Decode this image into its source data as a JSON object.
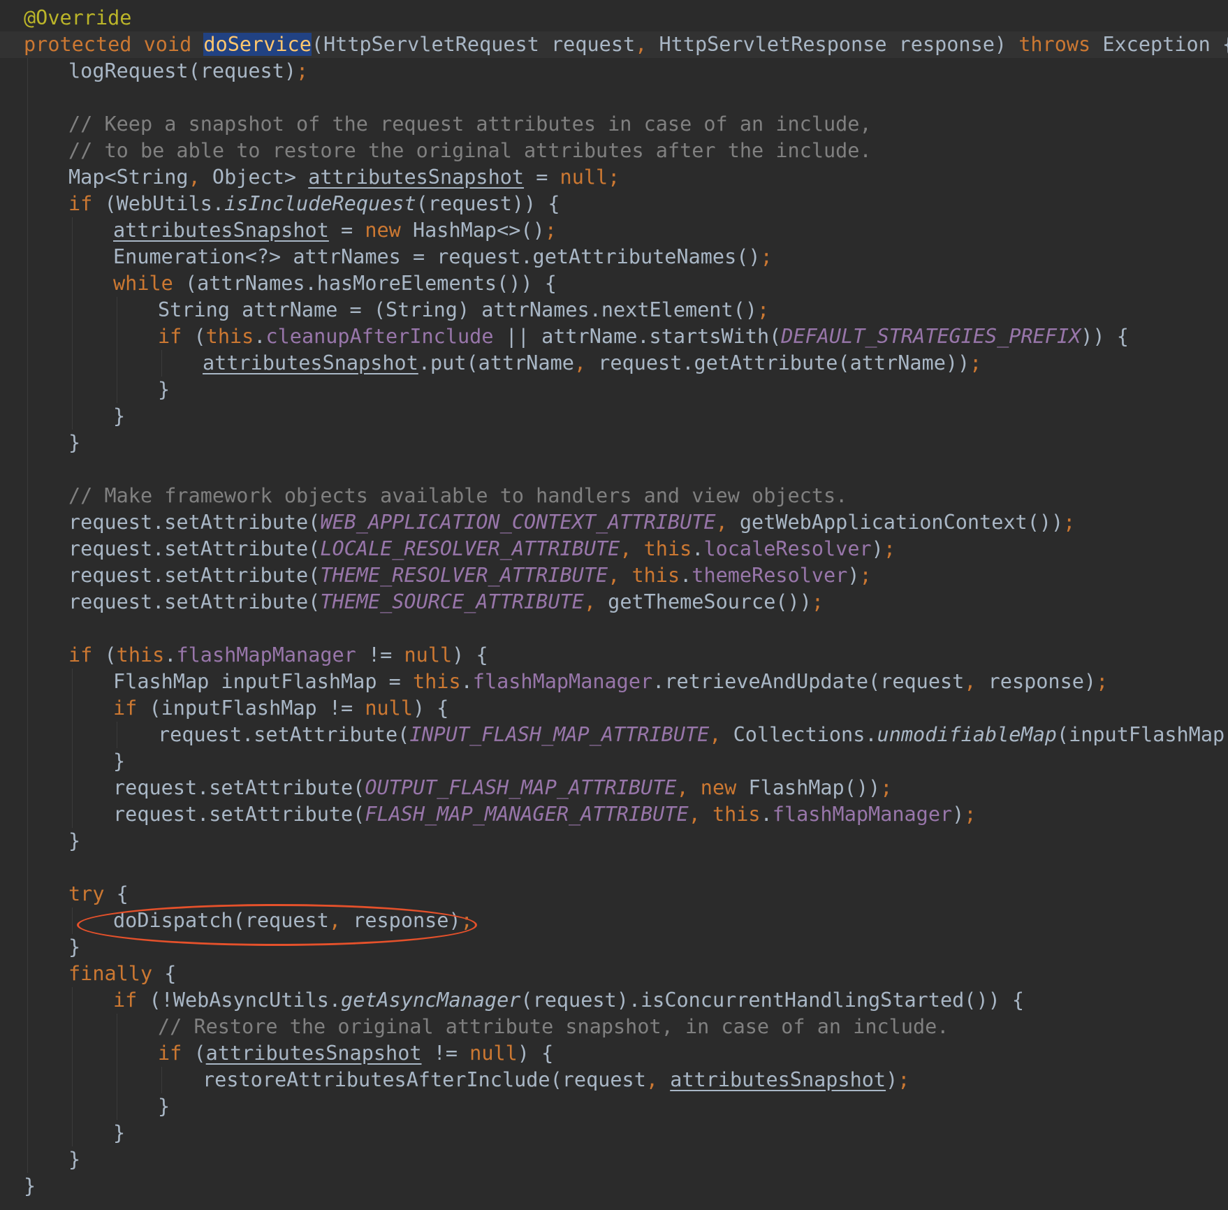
{
  "editor": {
    "language": "java",
    "colors": {
      "background": "#2b2b2b",
      "caret_row": "#323232",
      "plain": "#a9b7c6",
      "keyword": "#cc7832",
      "annotation": "#bbb529",
      "comment": "#808080",
      "field": "#9876aa",
      "method_declaration": "#ffc66d",
      "usage_highlight": "#214283",
      "annotation_ellipse": "#e5512b"
    },
    "lines": [
      {
        "indent": 0,
        "tokens": [
          {
            "t": "@Override",
            "c": "ann"
          }
        ]
      },
      {
        "indent": 0,
        "caret": true,
        "tokens": [
          {
            "t": "protected",
            "c": "kw"
          },
          {
            "t": " ",
            "c": "plain"
          },
          {
            "t": "void",
            "c": "kw"
          },
          {
            "t": " ",
            "c": "plain"
          },
          {
            "t": "doService",
            "c": "hl"
          },
          {
            "t": "(HttpServletRequest request",
            "c": "plain"
          },
          {
            "t": ",",
            "c": "punc"
          },
          {
            "t": " HttpServletResponse response) ",
            "c": "plain"
          },
          {
            "t": "throws",
            "c": "kw"
          },
          {
            "t": " Exception {",
            "c": "plain"
          }
        ]
      },
      {
        "indent": 1,
        "tokens": [
          {
            "t": "logRequest(request)",
            "c": "plain"
          },
          {
            "t": ";",
            "c": "punc"
          }
        ]
      },
      {
        "indent": 1,
        "tokens": []
      },
      {
        "indent": 1,
        "tokens": [
          {
            "t": "// Keep a snapshot of the request attributes in case of an include,",
            "c": "comment"
          }
        ]
      },
      {
        "indent": 1,
        "tokens": [
          {
            "t": "// to be able to restore the original attributes after the include.",
            "c": "comment"
          }
        ]
      },
      {
        "indent": 1,
        "tokens": [
          {
            "t": "Map<String",
            "c": "plain"
          },
          {
            "t": ",",
            "c": "punc"
          },
          {
            "t": " Object> ",
            "c": "plain"
          },
          {
            "t": "attributesSnapshot",
            "c": "local"
          },
          {
            "t": " = ",
            "c": "plain"
          },
          {
            "t": "null;",
            "c": "kw"
          }
        ]
      },
      {
        "indent": 1,
        "tokens": [
          {
            "t": "if",
            "c": "kw"
          },
          {
            "t": " (WebUtils.",
            "c": "plain"
          },
          {
            "t": "isIncludeRequest",
            "c": "static"
          },
          {
            "t": "(request)) {",
            "c": "plain"
          }
        ]
      },
      {
        "indent": 2,
        "tokens": [
          {
            "t": "attributesSnapshot",
            "c": "local"
          },
          {
            "t": " = ",
            "c": "plain"
          },
          {
            "t": "new",
            "c": "kw"
          },
          {
            "t": " HashMap<>()",
            "c": "plain"
          },
          {
            "t": ";",
            "c": "punc"
          }
        ]
      },
      {
        "indent": 2,
        "tokens": [
          {
            "t": "Enumeration<?> attrNames = request.getAttributeNames()",
            "c": "plain"
          },
          {
            "t": ";",
            "c": "punc"
          }
        ]
      },
      {
        "indent": 2,
        "tokens": [
          {
            "t": "while",
            "c": "kw"
          },
          {
            "t": " (attrNames.hasMoreElements()) {",
            "c": "plain"
          }
        ]
      },
      {
        "indent": 3,
        "tokens": [
          {
            "t": "String attrName = (String) attrNames.nextElement()",
            "c": "plain"
          },
          {
            "t": ";",
            "c": "punc"
          }
        ]
      },
      {
        "indent": 3,
        "tokens": [
          {
            "t": "if",
            "c": "kw"
          },
          {
            "t": " (",
            "c": "plain"
          },
          {
            "t": "this",
            "c": "kw"
          },
          {
            "t": ".",
            "c": "plain"
          },
          {
            "t": "cleanupAfterInclude",
            "c": "field"
          },
          {
            "t": " || attrName.startsWith(",
            "c": "plain"
          },
          {
            "t": "DEFAULT_STRATEGIES_PREFIX",
            "c": "const"
          },
          {
            "t": ")) {",
            "c": "plain"
          }
        ]
      },
      {
        "indent": 4,
        "tokens": [
          {
            "t": "attributesSnapshot",
            "c": "local"
          },
          {
            "t": ".put(attrName",
            "c": "plain"
          },
          {
            "t": ",",
            "c": "punc"
          },
          {
            "t": " request.getAttribute(attrName))",
            "c": "plain"
          },
          {
            "t": ";",
            "c": "punc"
          }
        ]
      },
      {
        "indent": 3,
        "tokens": [
          {
            "t": "}",
            "c": "plain"
          }
        ]
      },
      {
        "indent": 2,
        "tokens": [
          {
            "t": "}",
            "c": "plain"
          }
        ]
      },
      {
        "indent": 1,
        "tokens": [
          {
            "t": "}",
            "c": "plain"
          }
        ]
      },
      {
        "indent": 1,
        "tokens": []
      },
      {
        "indent": 1,
        "tokens": [
          {
            "t": "// Make framework objects available to handlers and view objects.",
            "c": "comment"
          }
        ]
      },
      {
        "indent": 1,
        "tokens": [
          {
            "t": "request.setAttribute(",
            "c": "plain"
          },
          {
            "t": "WEB_APPLICATION_CONTEXT_ATTRIBUTE",
            "c": "const"
          },
          {
            "t": ",",
            "c": "punc"
          },
          {
            "t": " getWebApplicationContext())",
            "c": "plain"
          },
          {
            "t": ";",
            "c": "punc"
          }
        ]
      },
      {
        "indent": 1,
        "tokens": [
          {
            "t": "request.setAttribute(",
            "c": "plain"
          },
          {
            "t": "LOCALE_RESOLVER_ATTRIBUTE",
            "c": "const"
          },
          {
            "t": ",",
            "c": "punc"
          },
          {
            "t": " ",
            "c": "plain"
          },
          {
            "t": "this",
            "c": "kw"
          },
          {
            "t": ".",
            "c": "plain"
          },
          {
            "t": "localeResolver",
            "c": "field"
          },
          {
            "t": ")",
            "c": "plain"
          },
          {
            "t": ";",
            "c": "punc"
          }
        ]
      },
      {
        "indent": 1,
        "tokens": [
          {
            "t": "request.setAttribute(",
            "c": "plain"
          },
          {
            "t": "THEME_RESOLVER_ATTRIBUTE",
            "c": "const"
          },
          {
            "t": ",",
            "c": "punc"
          },
          {
            "t": " ",
            "c": "plain"
          },
          {
            "t": "this",
            "c": "kw"
          },
          {
            "t": ".",
            "c": "plain"
          },
          {
            "t": "themeResolver",
            "c": "field"
          },
          {
            "t": ")",
            "c": "plain"
          },
          {
            "t": ";",
            "c": "punc"
          }
        ]
      },
      {
        "indent": 1,
        "tokens": [
          {
            "t": "request.setAttribute(",
            "c": "plain"
          },
          {
            "t": "THEME_SOURCE_ATTRIBUTE",
            "c": "const"
          },
          {
            "t": ",",
            "c": "punc"
          },
          {
            "t": " getThemeSource())",
            "c": "plain"
          },
          {
            "t": ";",
            "c": "punc"
          }
        ]
      },
      {
        "indent": 1,
        "tokens": []
      },
      {
        "indent": 1,
        "tokens": [
          {
            "t": "if",
            "c": "kw"
          },
          {
            "t": " (",
            "c": "plain"
          },
          {
            "t": "this",
            "c": "kw"
          },
          {
            "t": ".",
            "c": "plain"
          },
          {
            "t": "flashMapManager",
            "c": "field"
          },
          {
            "t": " != ",
            "c": "plain"
          },
          {
            "t": "null",
            "c": "kw"
          },
          {
            "t": ") {",
            "c": "plain"
          }
        ]
      },
      {
        "indent": 2,
        "tokens": [
          {
            "t": "FlashMap inputFlashMap = ",
            "c": "plain"
          },
          {
            "t": "this",
            "c": "kw"
          },
          {
            "t": ".",
            "c": "plain"
          },
          {
            "t": "flashMapManager",
            "c": "field"
          },
          {
            "t": ".retrieveAndUpdate(request",
            "c": "plain"
          },
          {
            "t": ",",
            "c": "punc"
          },
          {
            "t": " response)",
            "c": "plain"
          },
          {
            "t": ";",
            "c": "punc"
          }
        ]
      },
      {
        "indent": 2,
        "tokens": [
          {
            "t": "if",
            "c": "kw"
          },
          {
            "t": " (inputFlashMap != ",
            "c": "plain"
          },
          {
            "t": "null",
            "c": "kw"
          },
          {
            "t": ") {",
            "c": "plain"
          }
        ]
      },
      {
        "indent": 3,
        "tokens": [
          {
            "t": "request.setAttribute(",
            "c": "plain"
          },
          {
            "t": "INPUT_FLASH_MAP_ATTRIBUTE",
            "c": "const"
          },
          {
            "t": ",",
            "c": "punc"
          },
          {
            "t": " Collections.",
            "c": "plain"
          },
          {
            "t": "unmodifiableMap",
            "c": "static"
          },
          {
            "t": "(inputFlashMap))",
            "c": "plain"
          },
          {
            "t": ";",
            "c": "punc"
          }
        ]
      },
      {
        "indent": 2,
        "tokens": [
          {
            "t": "}",
            "c": "plain"
          }
        ]
      },
      {
        "indent": 2,
        "tokens": [
          {
            "t": "request.setAttribute(",
            "c": "plain"
          },
          {
            "t": "OUTPUT_FLASH_MAP_ATTRIBUTE",
            "c": "const"
          },
          {
            "t": ",",
            "c": "punc"
          },
          {
            "t": " ",
            "c": "plain"
          },
          {
            "t": "new",
            "c": "kw"
          },
          {
            "t": " FlashMap())",
            "c": "plain"
          },
          {
            "t": ";",
            "c": "punc"
          }
        ]
      },
      {
        "indent": 2,
        "tokens": [
          {
            "t": "request.setAttribute(",
            "c": "plain"
          },
          {
            "t": "FLASH_MAP_MANAGER_ATTRIBUTE",
            "c": "const"
          },
          {
            "t": ",",
            "c": "punc"
          },
          {
            "t": " ",
            "c": "plain"
          },
          {
            "t": "this",
            "c": "kw"
          },
          {
            "t": ".",
            "c": "plain"
          },
          {
            "t": "flashMapManager",
            "c": "field"
          },
          {
            "t": ")",
            "c": "plain"
          },
          {
            "t": ";",
            "c": "punc"
          }
        ]
      },
      {
        "indent": 1,
        "tokens": [
          {
            "t": "}",
            "c": "plain"
          }
        ]
      },
      {
        "indent": 1,
        "tokens": []
      },
      {
        "indent": 1,
        "tokens": [
          {
            "t": "try",
            "c": "kw"
          },
          {
            "t": " {",
            "c": "plain"
          }
        ]
      },
      {
        "indent": 2,
        "tokens": [
          {
            "t": "doDispatch(request",
            "c": "plain"
          },
          {
            "t": ",",
            "c": "punc"
          },
          {
            "t": " response)",
            "c": "plain"
          },
          {
            "t": ";",
            "c": "punc"
          }
        ]
      },
      {
        "indent": 1,
        "tokens": [
          {
            "t": "}",
            "c": "plain"
          }
        ]
      },
      {
        "indent": 1,
        "tokens": [
          {
            "t": "finally",
            "c": "kw"
          },
          {
            "t": " {",
            "c": "plain"
          }
        ]
      },
      {
        "indent": 2,
        "tokens": [
          {
            "t": "if",
            "c": "kw"
          },
          {
            "t": " (!WebAsyncUtils.",
            "c": "plain"
          },
          {
            "t": "getAsyncManager",
            "c": "static"
          },
          {
            "t": "(request).isConcurrentHandlingStarted()) {",
            "c": "plain"
          }
        ]
      },
      {
        "indent": 3,
        "tokens": [
          {
            "t": "// Restore the original attribute snapshot, in case of an include.",
            "c": "comment"
          }
        ]
      },
      {
        "indent": 3,
        "tokens": [
          {
            "t": "if",
            "c": "kw"
          },
          {
            "t": " (",
            "c": "plain"
          },
          {
            "t": "attributesSnapshot",
            "c": "local"
          },
          {
            "t": " != ",
            "c": "plain"
          },
          {
            "t": "null",
            "c": "kw"
          },
          {
            "t": ") {",
            "c": "plain"
          }
        ]
      },
      {
        "indent": 4,
        "tokens": [
          {
            "t": "restoreAttributesAfterInclude(request",
            "c": "plain"
          },
          {
            "t": ",",
            "c": "punc"
          },
          {
            "t": " ",
            "c": "plain"
          },
          {
            "t": "attributesSnapshot",
            "c": "local"
          },
          {
            "t": ")",
            "c": "plain"
          },
          {
            "t": ";",
            "c": "punc"
          }
        ]
      },
      {
        "indent": 3,
        "tokens": [
          {
            "t": "}",
            "c": "plain"
          }
        ]
      },
      {
        "indent": 2,
        "tokens": [
          {
            "t": "}",
            "c": "plain"
          }
        ]
      },
      {
        "indent": 1,
        "tokens": [
          {
            "t": "}",
            "c": "plain"
          }
        ]
      },
      {
        "indent": 0,
        "tokens": [
          {
            "t": "}",
            "c": "plain"
          }
        ]
      }
    ]
  },
  "annotations": [
    {
      "type": "ellipse",
      "target_line": 34,
      "color": "#e5512b"
    }
  ]
}
